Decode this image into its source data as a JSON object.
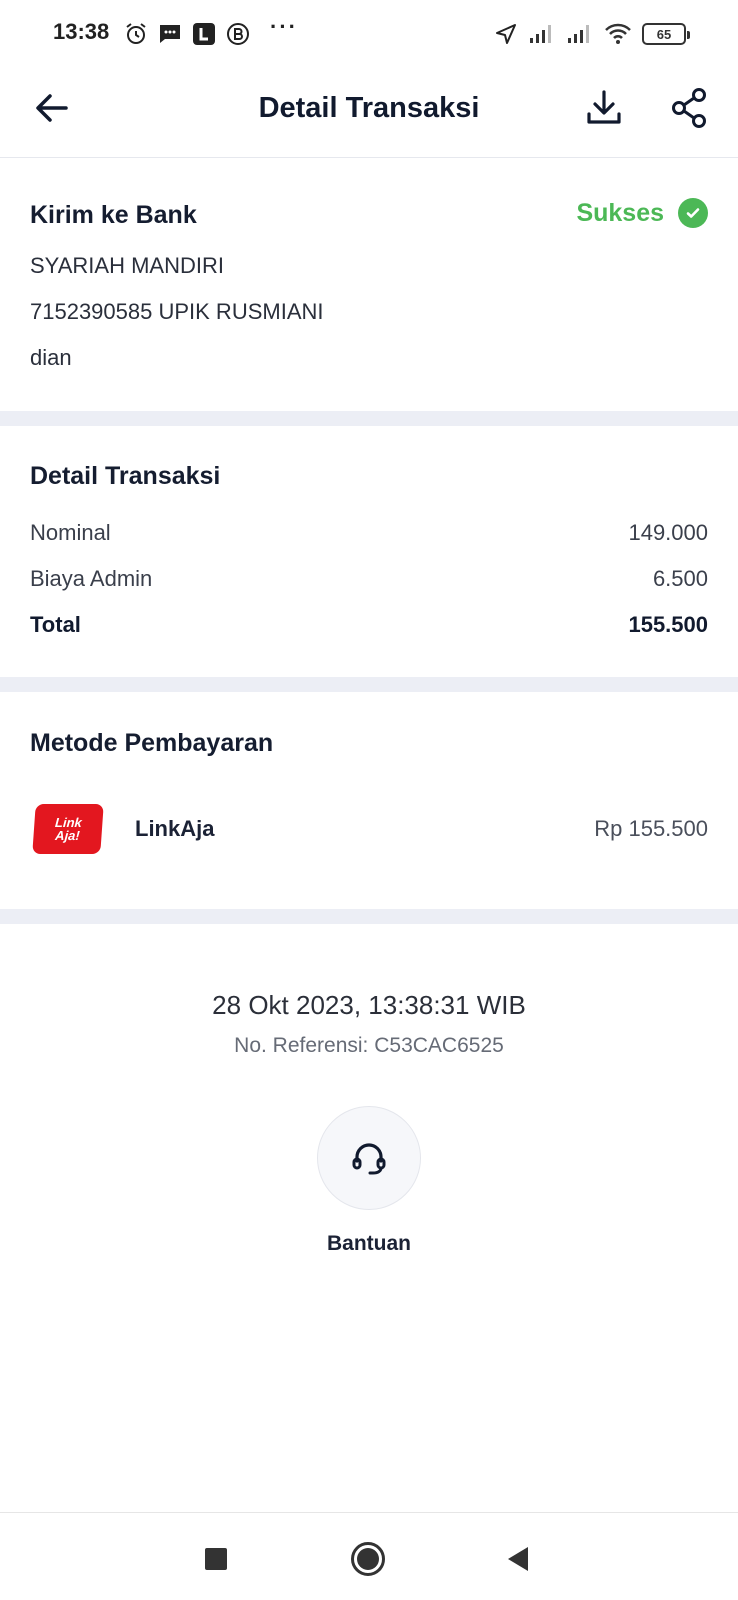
{
  "status_bar": {
    "time": "13:38",
    "battery": "65",
    "left_icons": [
      "alarm-icon",
      "message-icon",
      "l-app-icon",
      "b-app-icon"
    ],
    "more": "···"
  },
  "header": {
    "title": "Detail Transaksi"
  },
  "recipient": {
    "title": "Kirim ke Bank",
    "status": "Sukses",
    "bank": "SYARIAH MANDIRI",
    "account": "7152390585 UPIK RUSMIANI",
    "note": "dian"
  },
  "details": {
    "title": "Detail Transaksi",
    "rows": [
      {
        "label": "Nominal",
        "value": "149.000"
      },
      {
        "label": "Biaya Admin",
        "value": "6.500"
      },
      {
        "label": "Total",
        "value": "155.500"
      }
    ]
  },
  "payment": {
    "title": "Metode Pembayaran",
    "logo_text_1": "Link",
    "logo_text_2": "Aja!",
    "method": "LinkAja",
    "amount": "Rp 155.500"
  },
  "info": {
    "datetime": "28 Okt 2023, 13:38:31 WIB",
    "reference": "No. Referensi: C53CAC6525"
  },
  "help": {
    "label": "Bantuan"
  },
  "colors": {
    "success": "#4cb856",
    "brand_red": "#e3171f",
    "divider": "#eceef5"
  }
}
